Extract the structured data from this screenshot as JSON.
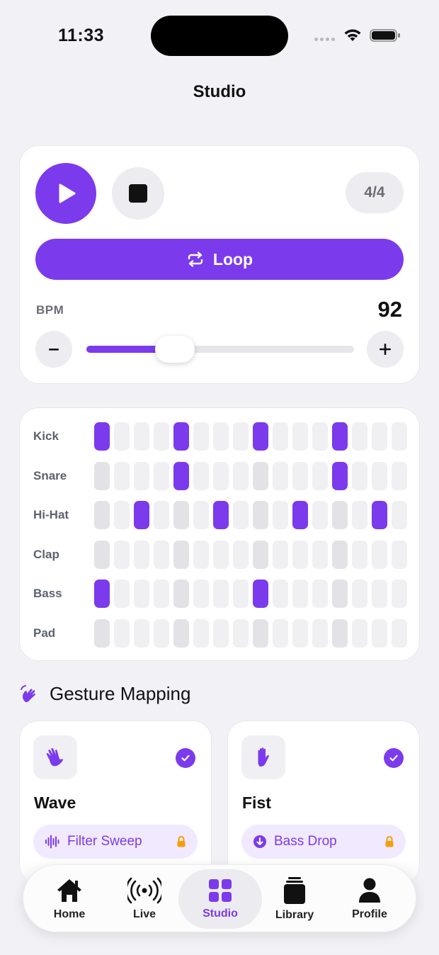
{
  "status_bar": {
    "time": "11:33"
  },
  "nav": {
    "title": "Studio"
  },
  "transport": {
    "time_signature": "4/4",
    "loop_label": "Loop",
    "bpm_label": "BPM",
    "bpm_value": "92",
    "bpm_slider_fraction": 0.33
  },
  "sequencer": {
    "steps_per_row": 16,
    "tracks": [
      {
        "name": "Kick",
        "active_steps": [
          1,
          5,
          9,
          13
        ]
      },
      {
        "name": "Snare",
        "active_steps": [
          5,
          13
        ]
      },
      {
        "name": "Hi-Hat",
        "active_steps": [
          3,
          7,
          11,
          15
        ]
      },
      {
        "name": "Clap",
        "active_steps": []
      },
      {
        "name": "Bass",
        "active_steps": [
          1,
          9
        ]
      },
      {
        "name": "Pad",
        "active_steps": []
      }
    ]
  },
  "gestures": {
    "section_title": "Gesture Mapping",
    "items": [
      {
        "name": "Wave",
        "action": "Filter Sweep",
        "icon": "wave-hand-icon",
        "action_icon": "waveform-icon",
        "enabled": true,
        "locked": true
      },
      {
        "name": "Fist",
        "action": "Bass Drop",
        "icon": "raised-hand-icon",
        "action_icon": "down-arrow-circle-icon",
        "enabled": true,
        "locked": true
      }
    ]
  },
  "tab_bar": {
    "tabs": [
      {
        "label": "Home",
        "icon": "house-icon",
        "active": false
      },
      {
        "label": "Live",
        "icon": "broadcast-icon",
        "active": false
      },
      {
        "label": "Studio",
        "icon": "grid-icon",
        "active": true
      },
      {
        "label": "Library",
        "icon": "stack-icon",
        "active": false
      },
      {
        "label": "Profile",
        "icon": "person-icon",
        "active": false
      }
    ]
  },
  "colors": {
    "accent": "#7c3aed",
    "background": "#f2f2f6",
    "card": "#ffffff"
  }
}
